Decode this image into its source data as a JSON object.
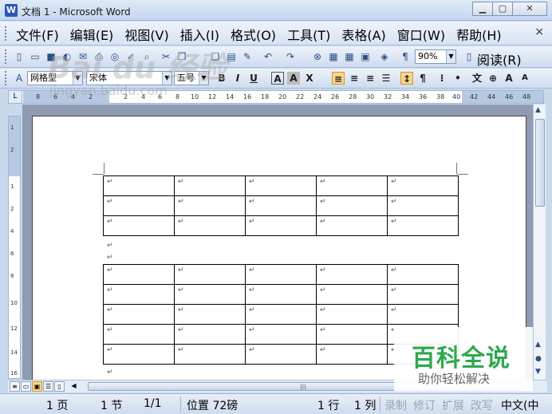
{
  "window": {
    "title": "文档 1 - Microsoft Word",
    "app_icon": "W"
  },
  "menu": {
    "items": [
      "文件(F)",
      "编辑(E)",
      "视图(V)",
      "插入(I)",
      "格式(O)",
      "工具(T)",
      "表格(A)",
      "窗口(W)",
      "帮助(H)"
    ],
    "close": "×"
  },
  "toolbar": {
    "zoom": "90%",
    "read_label": "阅读(R)"
  },
  "formatting": {
    "style": "网格型",
    "font": "宋体",
    "size": "五号"
  },
  "ruler": {
    "ticks": [
      "8",
      "6",
      "4",
      "2",
      "2",
      "4",
      "6",
      "8",
      "10",
      "12",
      "14",
      "16",
      "18",
      "20",
      "22",
      "24",
      "26",
      "28",
      "30",
      "32",
      "34",
      "36",
      "38",
      "40",
      "42",
      "44",
      "46",
      "48"
    ]
  },
  "vruler": {
    "ticks": [
      "1",
      "2",
      "1",
      "2",
      "4",
      "6",
      "8",
      "10",
      "12",
      "14",
      "16"
    ]
  },
  "document": {
    "para_mark": "↵",
    "table1": {
      "rows": 3,
      "cols": 5
    },
    "table2": {
      "rows": 5,
      "cols": 5
    }
  },
  "statusbar": {
    "page": "1 页",
    "section": "1 节",
    "page_of": "1/1",
    "position": "位置 72磅",
    "line": "1 行",
    "column": "1 列",
    "rec": "录制",
    "trk": "修订",
    "ext": "扩展",
    "ovr": "改写",
    "lang": "中文(中"
  },
  "watermark": {
    "title": "百科全说",
    "subtitle": "助你轻松解决",
    "baidu": "Bai du 经验",
    "baidu_url": "jingyan.baidu.com"
  },
  "colors": {
    "accent": "#2fa84f",
    "chrome": "#d7e3f3"
  }
}
